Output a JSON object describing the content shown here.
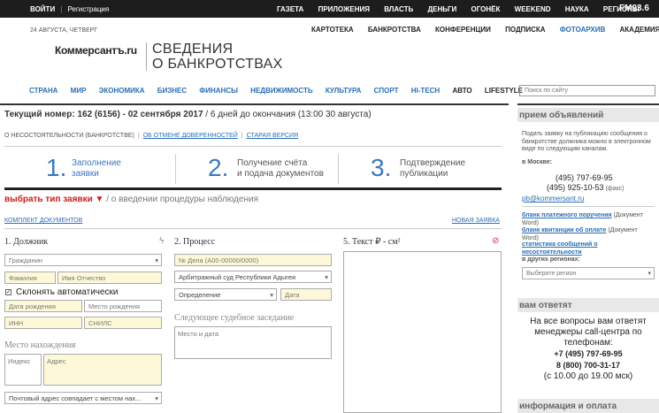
{
  "topbar": {
    "login": "ВОЙТИ",
    "register": "Регистрация",
    "items": [
      "ГАЗЕТА",
      "ПРИЛОЖЕНИЯ",
      "ВЛАСТЬ",
      "ДЕНЬГИ",
      "ОГОНЁК",
      "WEEKEND",
      "НАУКА",
      "РЕГИОНЫ"
    ],
    "radio": "FM93.6"
  },
  "date": "24 АВГУСТА, ЧЕТВЕРГ",
  "subnav": [
    "КАРТОТЕКА",
    "БАНКРОТСТВА",
    "КОНФЕРЕНЦИИ",
    "ПОДПИСКА",
    "ФОТОАРХИВ",
    "АКАДЕМИЯ"
  ],
  "logo": {
    "brand": "Коммерсантъ.ru",
    "title_line1": "СВЕДЕНИЯ",
    "title_line2": "О БАНКРОТСТВАХ"
  },
  "mainnav": [
    "СТРАНА",
    "МИР",
    "ЭКОНОМИКА",
    "БИЗНЕС",
    "ФИНАНСЫ",
    "НЕДВИЖИМОСТЬ",
    "КУЛЬТУРА",
    "СПОРТ",
    "HI-TECH",
    "АВТО",
    "LIFESTYLE"
  ],
  "search": {
    "placeholder": "Поиск по сайту"
  },
  "issue": {
    "label": "Текущий номер: 162 (6156) - 02 сентября 2017",
    "rest": " / 6 дней до окончания (13:00 30 августа)"
  },
  "crumbs": {
    "current": "О НЕСОСТОЯТЕЛЬНОСТИ (БАНКРОТСТВЕ)",
    "link1": "ОБ ОТМЕНЕ ДОВЕРЕННОСТЕЙ",
    "link2": "СТАРАЯ ВЕРСИЯ"
  },
  "steps": [
    {
      "num": "1.",
      "line1": "Заполнение",
      "line2": "заявки"
    },
    {
      "num": "2.",
      "line1": "Получение счёта",
      "line2": "и подача документов"
    },
    {
      "num": "3.",
      "line1": "Подтверждение",
      "line2": "публикации"
    }
  ],
  "request_type": {
    "label": "выбрать тип заявки ▼",
    "value": " / о введении процедуры наблюдения"
  },
  "doc_kit": "КОМПЛЕКТ ДОКУМЕНТОВ",
  "new_request": "НОВАЯ ЗАЯВКА",
  "debtor": {
    "title": "1. Должник",
    "type": "Гражданин",
    "surname": "Фамилия",
    "name": "Имя Отчество",
    "auto_decline": "Склонять автоматически",
    "birth_date": "Дата рождения",
    "birth_place": "Место рождения",
    "inn": "ИНН",
    "snils": "СНИЛС",
    "location_label": "Место нахождения",
    "index": "Индекс",
    "address": "Адрес",
    "postal": "Почтовый адрес совпадает с местом нах..."
  },
  "process": {
    "title": "2. Процесс",
    "case_no": "№ Дела (А00-00000/0000)",
    "court": "Арбитражный суд Республики Адыгея",
    "doc_type": "Определение",
    "date": "Дата",
    "next_label": "Следующее судебное заседание",
    "place_date": "Место и дата"
  },
  "text": {
    "title": "5. Текст ₽ - см²"
  },
  "sidebar": {
    "ads_title": "прием объявлений",
    "ads_text": "Подать заявку на публикацию сообщения о банкротстве должника можно в электронном виде по следующим каналам.",
    "moscow": "в Москве:",
    "phone1": "(495) 797-69-95",
    "phone2": "(495) 925-10-53",
    "fax": " (факс)",
    "email": "pb@kommersant.ru",
    "doc1": "бланк платежного поручения",
    "doc1_note": " (Документ Word)",
    "doc2": "бланк квитанции об оплате",
    "doc2_note": " (Документ Word)",
    "doc3": "статистика сообщений о несостоятельности",
    "regions": "в других регионах:",
    "region_select": "Выберите регион",
    "answer_title": "вам ответят",
    "answer_text": "На все вопросы вам ответят менеджеры call-центра по телефонам:",
    "answer_phone1": "+7 (495) 797-69-95",
    "answer_phone2": "8 (800) 700-31-17",
    "hours": "(с 10.00 до 19.00 мск)",
    "info_title": "информация и оплата"
  }
}
